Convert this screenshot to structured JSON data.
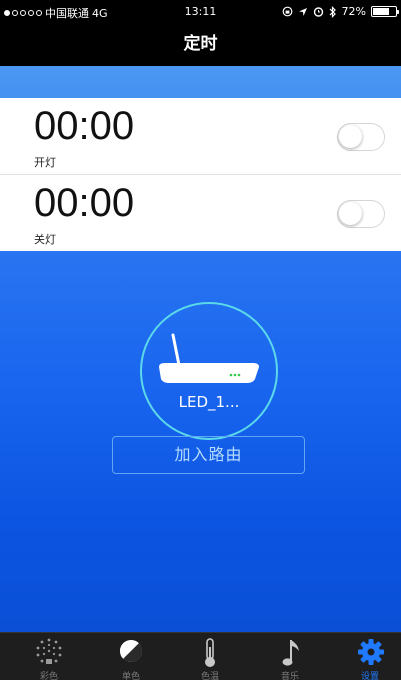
{
  "status_bar": {
    "carrier": "中国联通",
    "network": "4G",
    "time": "13:11",
    "battery_percent": "72%",
    "battery_level": 0.72
  },
  "title": "定时",
  "timers": [
    {
      "time": "00:00",
      "label": "开灯",
      "enabled": false
    },
    {
      "time": "00:00",
      "label": "关灯",
      "enabled": false
    }
  ],
  "device": {
    "name": "LED_1...",
    "join_button": "加入路由"
  },
  "tabs": [
    {
      "label": "彩色",
      "icon": "color-wheel-icon"
    },
    {
      "label": "单色",
      "icon": "half-circle-icon"
    },
    {
      "label": "色温",
      "icon": "thermometer-icon"
    },
    {
      "label": "音乐",
      "icon": "music-note-icon"
    },
    {
      "label": "设置",
      "icon": "gear-icon",
      "active": true
    }
  ],
  "colors": {
    "accent": "#1f7aff",
    "ring": "#5bd8ea",
    "background_top": "#4b97f2",
    "background_bottom": "#0a4fd6"
  }
}
